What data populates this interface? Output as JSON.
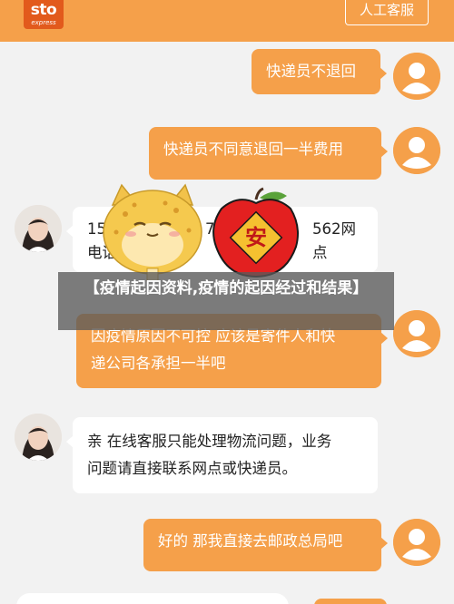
{
  "header": {
    "logo_main": "sto",
    "logo_sub": "express",
    "service_button": "人工客服"
  },
  "messages": [
    {
      "from": "user",
      "text": "快递员不退回"
    },
    {
      "from": "user",
      "text": "快递员不同意退回一半费用"
    },
    {
      "from": "agent",
      "text_line1": "15",
      "text_mid": "7",
      "text_right": "562网点",
      "text_line2": "电话"
    },
    {
      "from": "user",
      "text_line1": "因疫情原因不可控 应该是寄件人和快",
      "text_line2": "递公司各承担一半吧"
    },
    {
      "from": "agent",
      "text_line1": "亲 在线客服只能处理物流问题，业务",
      "text_line2": "问题请直接联系网点或快递员。"
    },
    {
      "from": "user",
      "text": "好的 那我直接去邮政总局吧"
    }
  ],
  "sticker": {
    "seal_char": "安"
  },
  "banner": {
    "text": "【疫情起因资料,疫情的起因经过和结果】"
  },
  "colors": {
    "brand_orange": "#f5a04a",
    "logo_red": "#e25a1c",
    "background": "#f2f2f2"
  },
  "icons": [
    "user-avatar-icon",
    "agent-avatar-icon",
    "cat-sticker-icon",
    "apple-sticker-icon"
  ]
}
